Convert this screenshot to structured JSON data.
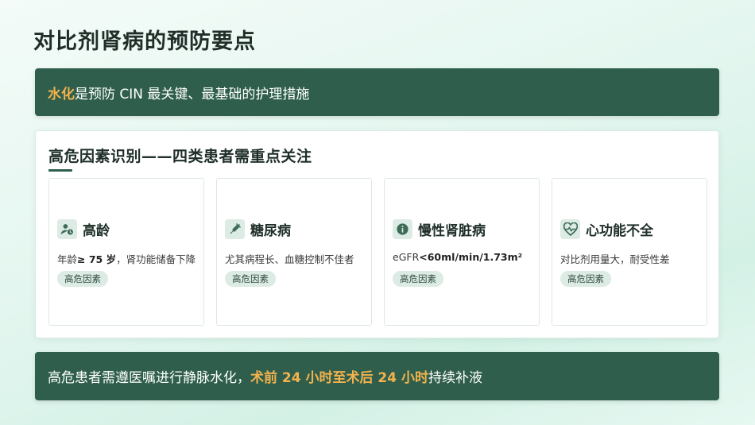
{
  "title": "对比剂肾病的预防要点",
  "top_banner": {
    "highlight": "水化",
    "text": "是预防 CIN 最关键、最基础的护理措施"
  },
  "panel": {
    "title": "高危因素识别——四类患者需重点关注",
    "cards": [
      {
        "icon": "user-clock-icon",
        "title": "高龄",
        "desc_prefix": "年龄",
        "desc_bold": "≥ 75 岁",
        "desc_suffix": "，肾功能储备下降",
        "tag": "高危因素"
      },
      {
        "icon": "syringe-icon",
        "title": "糖尿病",
        "desc_prefix": "尤其病程长、血糖控制不佳者",
        "desc_bold": "",
        "desc_suffix": "",
        "tag": "高危因素"
      },
      {
        "icon": "info-icon",
        "title": "慢性肾脏病",
        "desc_prefix": "eGFR",
        "desc_bold": "<60ml/min/1.73m²",
        "desc_suffix": "",
        "tag": "高危因素"
      },
      {
        "icon": "heart-pulse-icon",
        "title": "心功能不全",
        "desc_prefix": "对比剂用量大，耐受性差",
        "desc_bold": "",
        "desc_suffix": "",
        "tag": "高危因素"
      }
    ]
  },
  "bottom_banner": {
    "prefix": "高危患者需遵医嘱进行静脉水化，",
    "highlight": "术前 24 小时至术后 24 小时",
    "suffix": "持续补液"
  },
  "colors": {
    "dark_green": "#2f5f4c",
    "accent_orange": "#f3b24d",
    "tag_bg": "#dcebe4"
  }
}
